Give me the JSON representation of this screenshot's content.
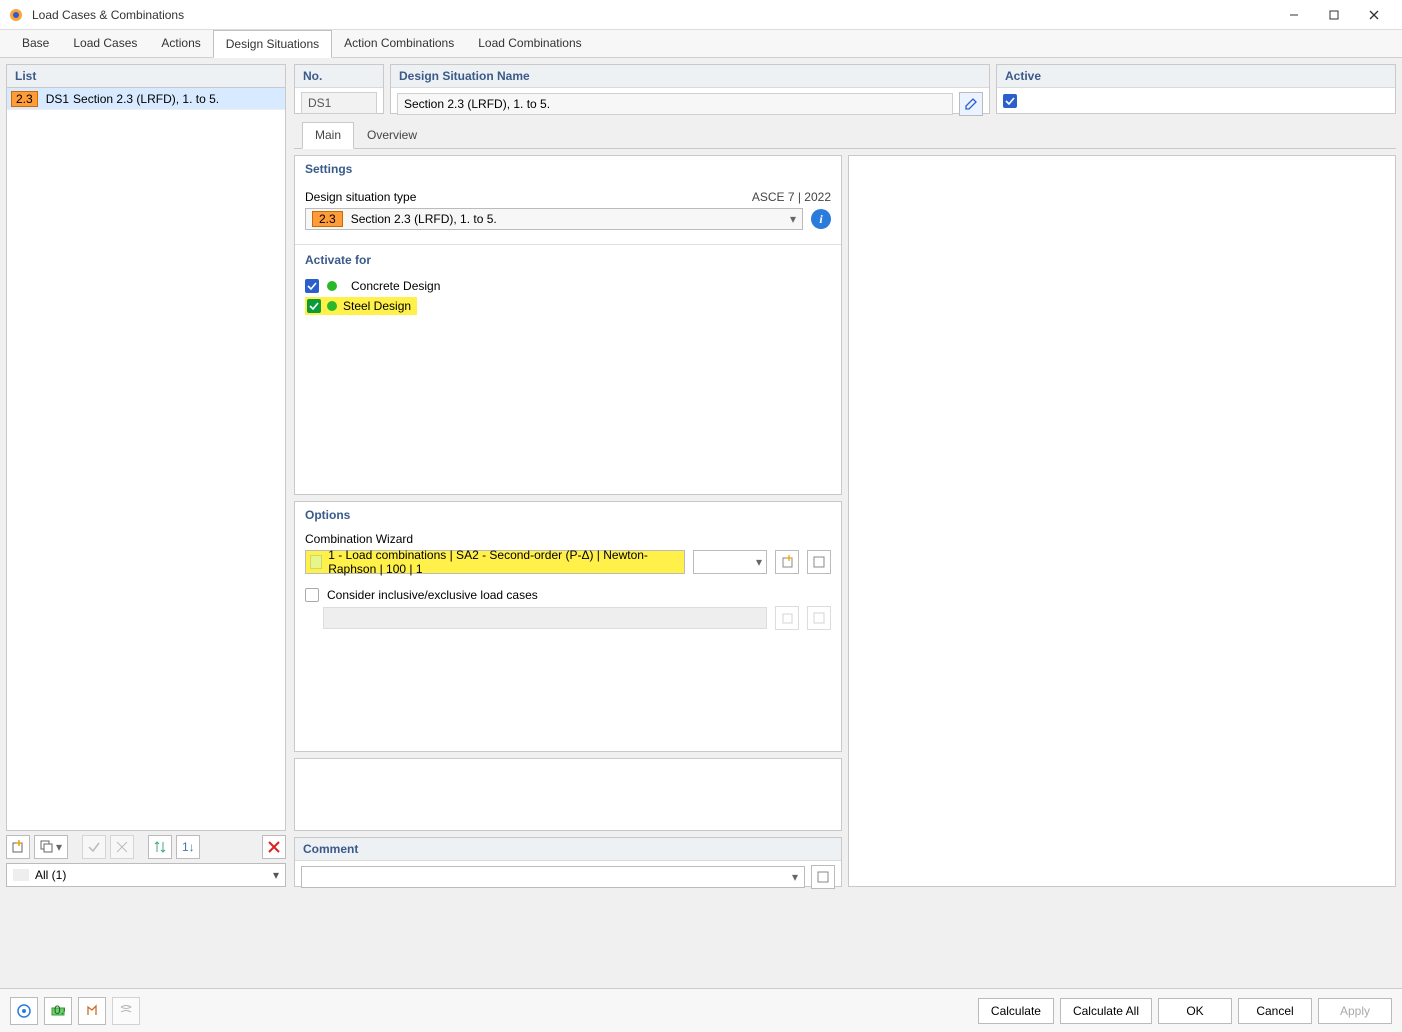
{
  "window": {
    "title": "Load Cases & Combinations"
  },
  "mainTabs": {
    "base": "Base",
    "loadCases": "Load Cases",
    "actions": "Actions",
    "designSituations": "Design Situations",
    "actionCombinations": "Action Combinations",
    "loadCombinations": "Load Combinations"
  },
  "list": {
    "header": "List",
    "row": {
      "code": "2.3",
      "id": "DS1",
      "name": "Section 2.3 (LRFD), 1. to 5."
    },
    "filter": "All (1)"
  },
  "top": {
    "noHeader": "No.",
    "noValue": "DS1",
    "nameHeader": "Design Situation Name",
    "nameValue": "Section 2.3 (LRFD), 1. to 5.",
    "activeHeader": "Active"
  },
  "subTabs": {
    "main": "Main",
    "overview": "Overview"
  },
  "settings": {
    "header": "Settings",
    "typeLabel": "Design situation type",
    "standard": "ASCE 7 | 2022",
    "typeCode": "2.3",
    "typeText": "Section 2.3 (LRFD), 1. to 5.",
    "activateHeader": "Activate for",
    "concrete": "Concrete Design",
    "steel": "Steel Design"
  },
  "options": {
    "header": "Options",
    "wizardLabel": "Combination Wizard",
    "wizardValue": "1 - Load combinations | SA2 - Second-order (P-Δ) | Newton-Raphson | 100 | 1",
    "considerLabel": "Consider inclusive/exclusive load cases"
  },
  "comment": {
    "header": "Comment"
  },
  "buttons": {
    "calculate": "Calculate",
    "calculateAll": "Calculate All",
    "ok": "OK",
    "cancel": "Cancel",
    "apply": "Apply"
  }
}
